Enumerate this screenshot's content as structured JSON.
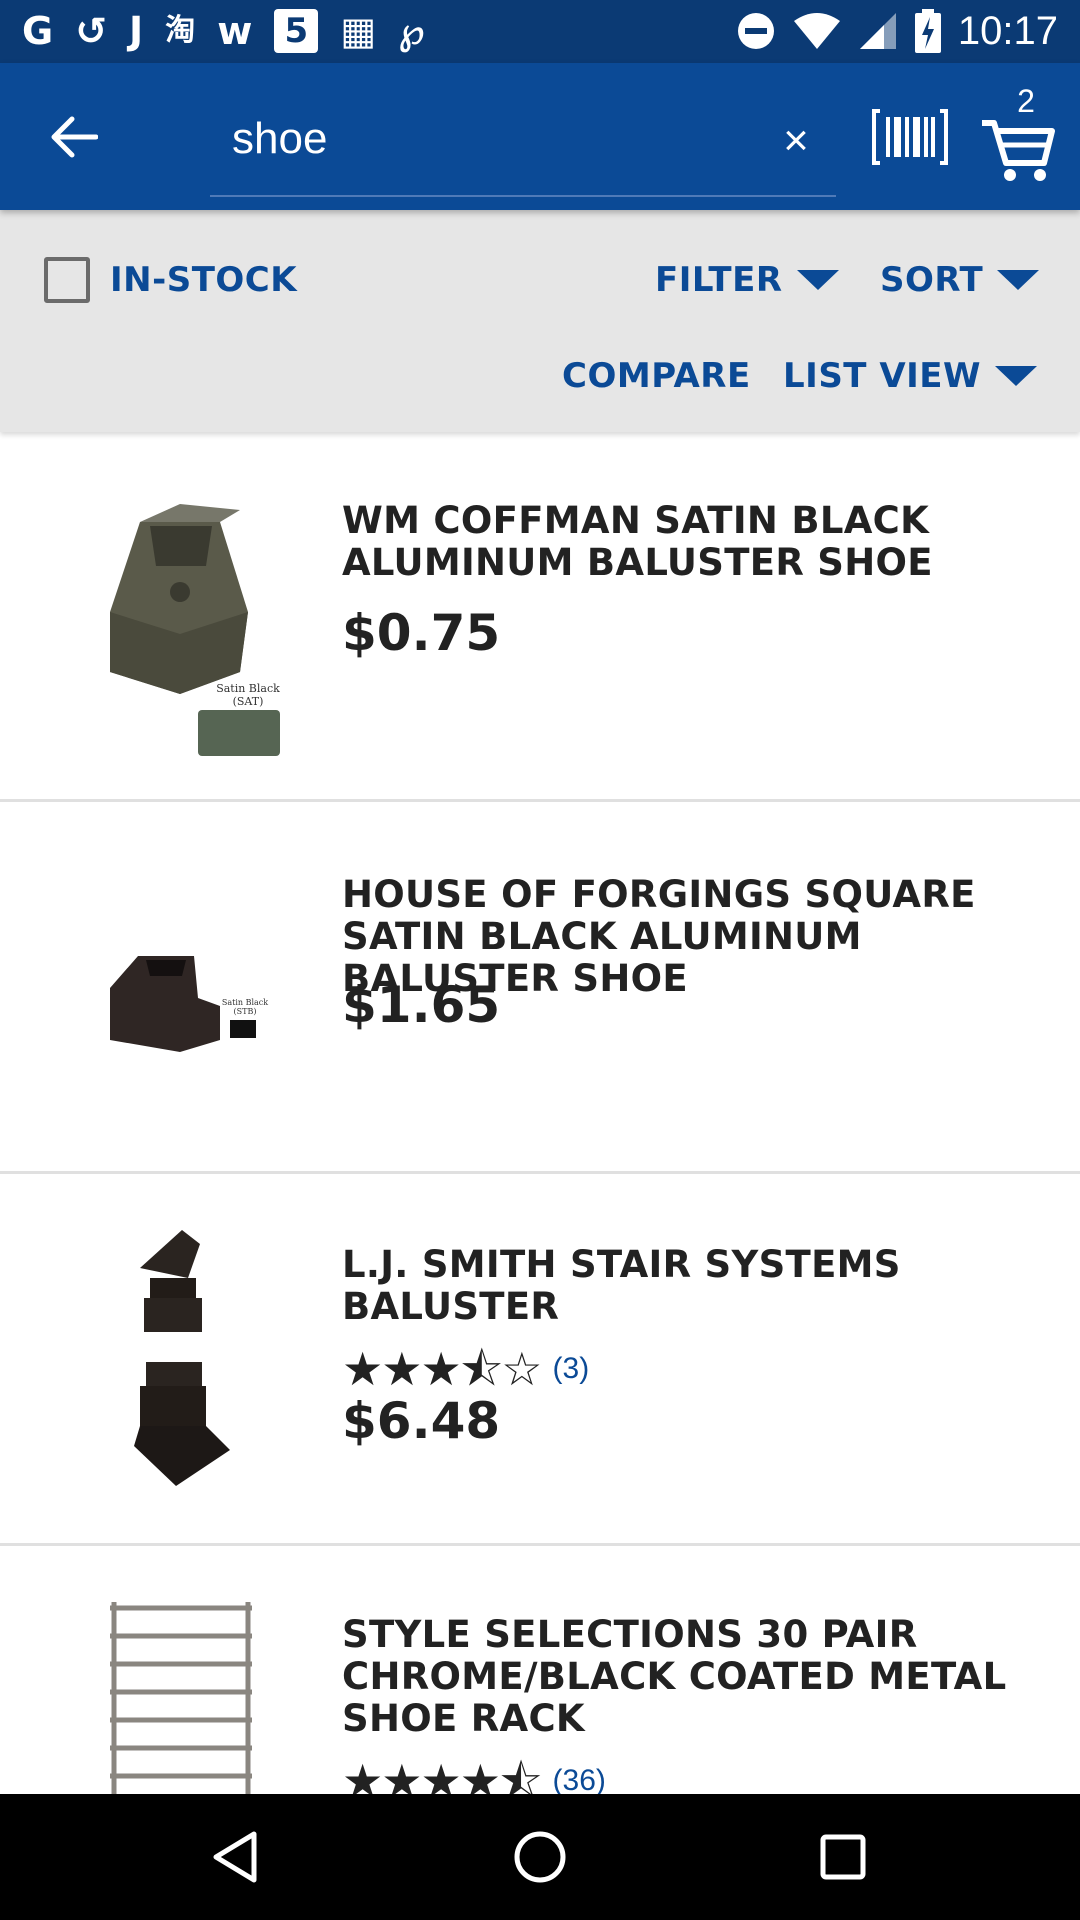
{
  "status_bar": {
    "left_icons": [
      "G",
      "↺",
      "J",
      "淘",
      "w",
      "5",
      "▦",
      "℘"
    ],
    "time": "10:17"
  },
  "search": {
    "value": "shoe",
    "clear_label": "×",
    "placeholder": ""
  },
  "cart": {
    "count": "2"
  },
  "filter_bar": {
    "in_stock_label": "IN-STOCK",
    "filter_label": "FILTER",
    "sort_label": "SORT",
    "compare_label": "COMPARE",
    "list_view_label": "LIST VIEW"
  },
  "products": [
    {
      "title": "WM COFFMAN SATIN BLACK ALUMINUM BALUSTER SHOE",
      "price": "$0.75",
      "thumb_caption": "Satin Black (SAT)"
    },
    {
      "title": "HOUSE OF FORGINGS SQUARE SATIN BLACK ALUMINUM BALUSTER SHOE",
      "price": "$1.65",
      "thumb_caption": "Satin Black (STB)"
    },
    {
      "title": "L.J. SMITH STAIR SYSTEMS BALUSTER",
      "price": "$6.48",
      "rating_stars": "★★★⯪☆",
      "rating_value": 3.5,
      "rating_count": "(3)"
    },
    {
      "title": "STYLE SELECTIONS 30 PAIR CHROME/BLACK COATED METAL SHOE RACK",
      "rating_stars": "★★★★⯪",
      "rating_value": 4.5,
      "rating_count": "(36)"
    }
  ],
  "colors": {
    "status_bar": "#0b3a74",
    "app_bar": "#0b4a96",
    "accent": "#0b4a96",
    "filter_bar": "#e6e6e6"
  }
}
